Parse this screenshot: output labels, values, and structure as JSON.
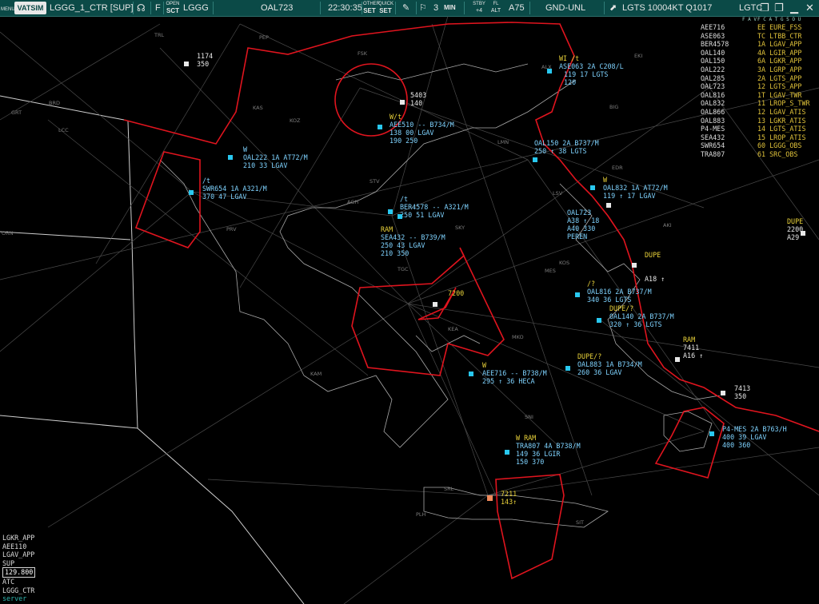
{
  "toolbar": {
    "menu": "MENU",
    "logo": "VATSIM",
    "callsign": "LGGG_1_CTR [SUP]",
    "f": "F",
    "open_label": "OPEN",
    "sct_label": "SCT",
    "airport": "LGGG",
    "selected_ac": "OAL723",
    "time": "22:30:35",
    "other_set_top": "OTHER",
    "other_set": "SET",
    "quick_set_top": "QUICK",
    "quick_set": "SET",
    "num": "3",
    "min": "MIN",
    "stby_top": "STBY",
    "stby": "+4",
    "fl_top": "FL",
    "fl": "ALT",
    "a75": "A75",
    "gnd": "GND-UNL",
    "metar": "LGTS 10004KT Q1017",
    "lgt": "LGTC"
  },
  "aircraft_list": {
    "header": "F A V",
    "items": [
      "AEE716",
      "ASE063",
      "BER4578",
      "OAL140",
      "OAL150",
      "OAL222",
      "OAL285",
      "OAL723",
      "OAL816",
      "OAL832",
      "OAL866",
      "OAL883",
      "P4-MES",
      "SEA432",
      "SWR654",
      "TRA807"
    ]
  },
  "atc_list": {
    "header": "F C A T G S O U",
    "items": [
      "EE EURE_FSS",
      "TC LTBB_CTR",
      "1A LGAV_APP",
      "4A LGIR_APP",
      "6A LGKR_APP",
      "3A LGRP_APP",
      "2A LGTS_APP",
      "12 LGTS_APP",
      "1T LGAV_TWR",
      "11 LROP_S_TWR",
      "12 LGAV_ATIS",
      "13 LGKR_ATIS",
      "14 LGTS_ATIS",
      "15 LROP_ATIS",
      "60 LGGG_OBS",
      "61 SRC_OBS"
    ]
  },
  "bottom_left": {
    "line1": "LGKR_APP",
    "line2": "AEE110",
    "line3": "LGAV_APP",
    "line4": "SUP",
    "freq": "129.800",
    "line6": "ATC",
    "line7": "LGGG_CTR",
    "line8": "server"
  },
  "scope": {
    "tags": [
      {
        "l1": "OAL222 1A AT72/M",
        "l2": "210 33 LGAV",
        "pre": "W"
      },
      {
        "l1": "SWR654 1A A321/M",
        "l2": "370 47 LGAV",
        "pre": "/t"
      },
      {
        "l1": "BER4578 -- A321/M",
        "l2": "250 51 LGAV",
        "pre": "/t"
      },
      {
        "l1": "SEA432 -- B739/M",
        "l2": "250 43 LGAV",
        "l3": "210 350",
        "pre": "RAM"
      },
      {
        "l1": "AEE510 -- B734/M",
        "l2": "138 00 LGAV",
        "l3": "190 250",
        "pre": "W/t"
      },
      {
        "l1": "ASE063 2A C208/L",
        "l2": "119 17 LGTS",
        "l3": "120",
        "pre": "WI /t"
      },
      {
        "l1": "OAL150 2A B737/M",
        "l2": "250 ↑ 38 LGTS"
      },
      {
        "l1": "OAL832 1A AT72/M",
        "l2": "119 ↑ 17 LGAV",
        "pre": "W"
      },
      {
        "l1": "OAL723",
        "l2": "A38 ↑ 18",
        "l3": "A40 330",
        "l4": "PEREN"
      },
      {
        "l1": "OAL816 2A B737/M",
        "l2": "340 36 LGTS",
        "pre": "/?"
      },
      {
        "l1": "OAL140 2A B737/M",
        "l2": "320 ↑ 36 LGTS",
        "pre": "DUPE/?"
      },
      {
        "l1": "OAL883 1A B734/M",
        "l2": "260 36 LGAV",
        "pre": "DUPE/?"
      },
      {
        "l1": "AEE716 -- B738/M",
        "l2": "295 ↑ 36 HECA",
        "pre": "W"
      },
      {
        "l1": "TRA807 4A B738/M",
        "l2": "149 36 LGIR",
        "l3": "150 370",
        "pre": "W RAM"
      },
      {
        "l1": "P4-MES 2A B763/H",
        "l2": "400 39 LGAV",
        "l3": "400 360"
      }
    ],
    "squawks": [
      {
        "code": "1174",
        "alt": "350"
      },
      {
        "code": "5403",
        "alt": "140"
      },
      {
        "code": "2200",
        "alt": "A29",
        "pre": "DUPE"
      },
      {
        "code": "7411",
        "alt": "A16 ↑",
        "pre": "RAM"
      },
      {
        "code": "7413",
        "alt": "350"
      },
      {
        "code": "7211",
        "alt": "143↑"
      },
      {
        "code": "7200"
      },
      {
        "code": "DUPE"
      },
      {
        "code": "A18 ↑"
      }
    ],
    "fixes": [
      "TRL",
      "PEP",
      "FSK",
      "KAS",
      "KOZ",
      "BRD",
      "GRT",
      "LCC",
      "STV",
      "AGH",
      "SKY",
      "TGC",
      "MES",
      "LSV",
      "KOS",
      "EDR",
      "AKI",
      "BIG",
      "EKI",
      "ALX",
      "LMN",
      "KEA",
      "MKO",
      "SNI",
      "SIT",
      "PLH",
      "SRL",
      "PRV",
      "KAM",
      "ORN"
    ],
    "colors": {
      "airspace": "#e0141e",
      "tag": "#7fd3ff",
      "alert": "#e9d23a",
      "vis": "#cfcfcf"
    }
  }
}
